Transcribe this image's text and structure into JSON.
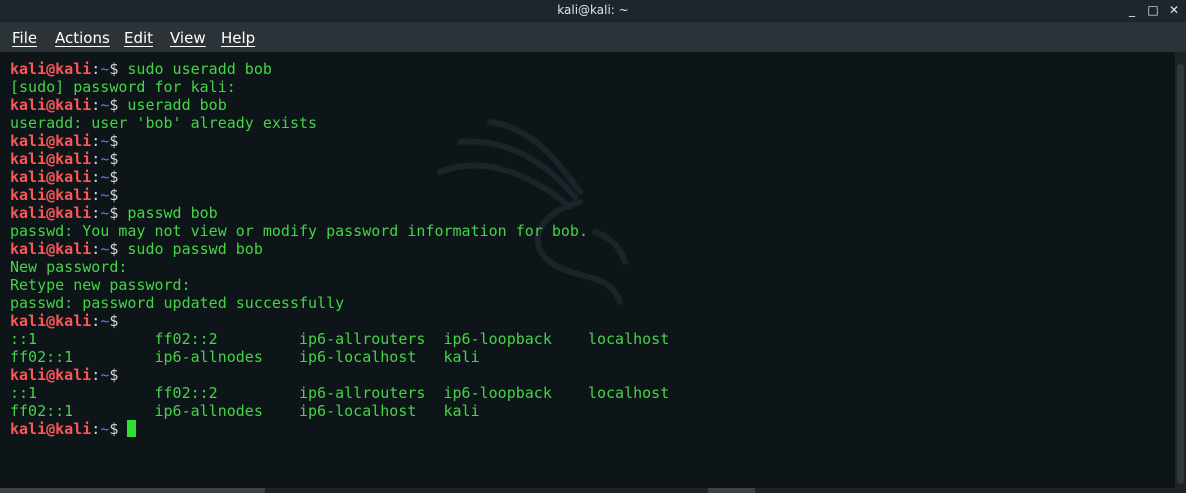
{
  "window": {
    "title": "kali@kali: ~",
    "controls": {
      "minimize": "_",
      "maximize": "□",
      "close": "✕"
    }
  },
  "menubar": {
    "items": [
      {
        "label": "File"
      },
      {
        "label": "Actions"
      },
      {
        "label": "Edit"
      },
      {
        "label": "View"
      },
      {
        "label": "Help"
      }
    ]
  },
  "terminal": {
    "prompt": {
      "user": "kali@kali",
      "path": "~",
      "symbol": "$"
    },
    "lines": [
      {
        "kind": "prompt",
        "command": " sudo useradd bob"
      },
      {
        "kind": "output",
        "text": "[sudo] password for kali:"
      },
      {
        "kind": "prompt",
        "command": " useradd bob"
      },
      {
        "kind": "output",
        "text": "useradd: user 'bob' already exists"
      },
      {
        "kind": "prompt",
        "command": ""
      },
      {
        "kind": "prompt",
        "command": ""
      },
      {
        "kind": "prompt",
        "command": ""
      },
      {
        "kind": "prompt",
        "command": ""
      },
      {
        "kind": "prompt",
        "command": " passwd bob"
      },
      {
        "kind": "output",
        "text": "passwd: You may not view or modify password information for bob."
      },
      {
        "kind": "prompt",
        "command": " sudo passwd bob"
      },
      {
        "kind": "output",
        "text": "New password:"
      },
      {
        "kind": "output",
        "text": "Retype new password:"
      },
      {
        "kind": "output",
        "text": "passwd: password updated successfully"
      },
      {
        "kind": "prompt",
        "command": ""
      },
      {
        "kind": "output",
        "text": "::1             ff02::2         ip6-allrouters  ip6-loopback    localhost"
      },
      {
        "kind": "output",
        "text": "ff02::1         ip6-allnodes    ip6-localhost   kali"
      },
      {
        "kind": "prompt",
        "command": ""
      },
      {
        "kind": "output",
        "text": "::1             ff02::2         ip6-allrouters  ip6-loopback    localhost"
      },
      {
        "kind": "output",
        "text": "ff02::1         ip6-allnodes    ip6-localhost   kali"
      },
      {
        "kind": "prompt",
        "command": " ",
        "cursor": true
      }
    ]
  },
  "colors": {
    "prompt_user": "#ff5555",
    "prompt_path": "#4d7fff",
    "output": "#44d445",
    "background": "#0d1519"
  }
}
